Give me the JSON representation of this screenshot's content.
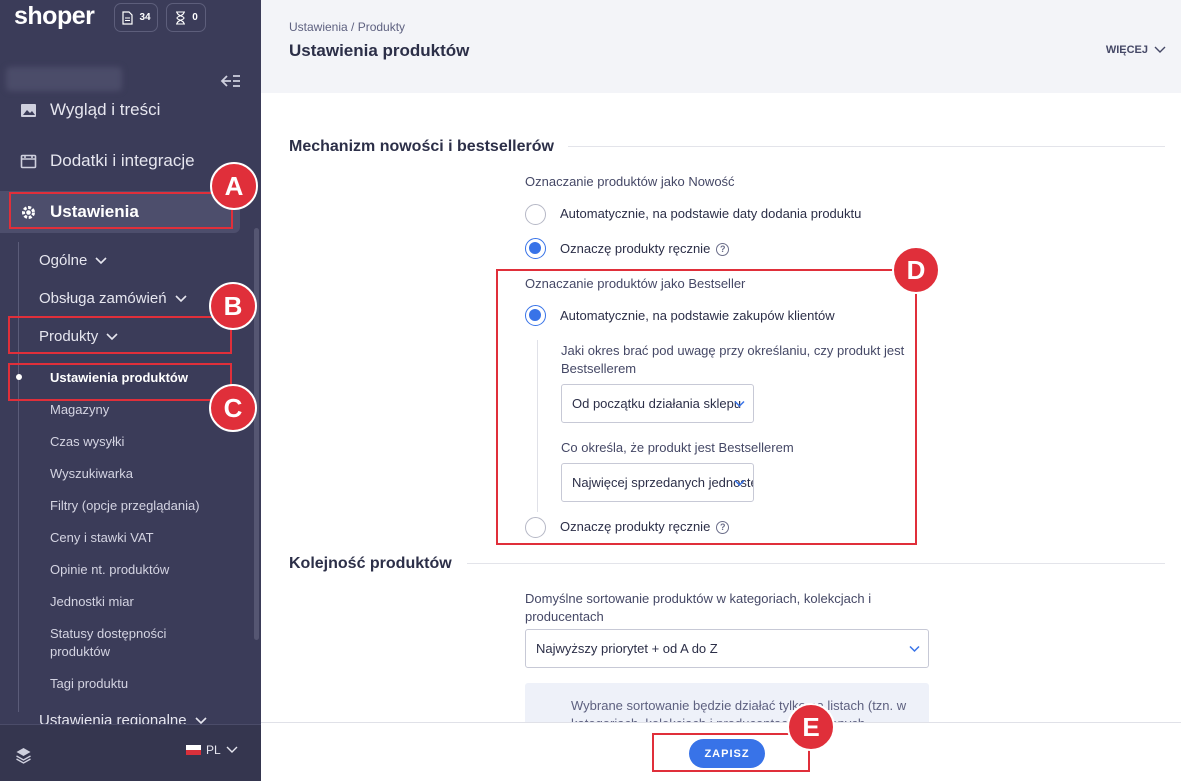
{
  "brand": {
    "logo": "shoper",
    "accent": "#3873e8",
    "annotation_color": "#e02f3a"
  },
  "counters": [
    {
      "icon": "document-icon",
      "value": "34"
    },
    {
      "icon": "hourglass-icon",
      "value": "0"
    }
  ],
  "sidebar": {
    "nav": [
      {
        "label": "Wygląd i treści",
        "icon": "image-icon"
      },
      {
        "label": "Dodatki i integracje",
        "icon": "calendar-icon"
      },
      {
        "label": "Ustawienia",
        "icon": "gear-icon",
        "active": true
      }
    ],
    "sub": [
      "Ogólne",
      "Obsługa zamówień",
      "Produkty"
    ],
    "products_items": [
      "Ustawienia produktów",
      "Magazyny",
      "Czas wysyłki",
      "Wyszukiwarka",
      "Filtry (opcje przeglądania)",
      "Ceny i stawki VAT",
      "Opinie nt. produktów",
      "Jednostki miar",
      "Statusy dostępności produktów",
      "Tagi produktu"
    ],
    "next_sub": "Ustawienia regionalne",
    "language": "PL"
  },
  "header": {
    "breadcrumb": "Ustawienia  /  Produkty",
    "title": "Ustawienia produktów",
    "more": "WIĘCEJ"
  },
  "section1": {
    "title": "Mechanizm nowości i bestsellerów",
    "new_label": "Oznaczanie produktów jako Nowość",
    "new_opt_auto": "Automatycznie, na podstawie daty dodania produktu",
    "new_opt_manual": "Oznaczę produkty ręcznie",
    "best_label": "Oznaczanie produktów jako Bestseller",
    "best_opt_auto": "Automatycznie, na podstawie zakupów klientów",
    "period_label": "Jaki okres brać pod uwagę przy określaniu, czy produkt jest Bestsellerem",
    "period_value": "Od początku działania sklepu",
    "criteria_label": "Co określa, że produkt jest Bestsellerem",
    "criteria_value": "Najwięcej sprzedanych jednostek",
    "best_opt_manual": "Oznaczę produkty ręcznie"
  },
  "section2": {
    "title": "Kolejność produktów",
    "sort_label": "Domyślne sortowanie produktów w kategoriach, kolekcjach i producentach",
    "sort_value": "Najwyższy priorytet + od A do Z",
    "info": "Wybrane sortowanie będzie działać tylko na listach (tzn. w kategoriach, kolekcjach i producentach) wybranych"
  },
  "save_label": "ZAPISZ",
  "markers": [
    "A",
    "B",
    "C",
    "D",
    "E"
  ]
}
